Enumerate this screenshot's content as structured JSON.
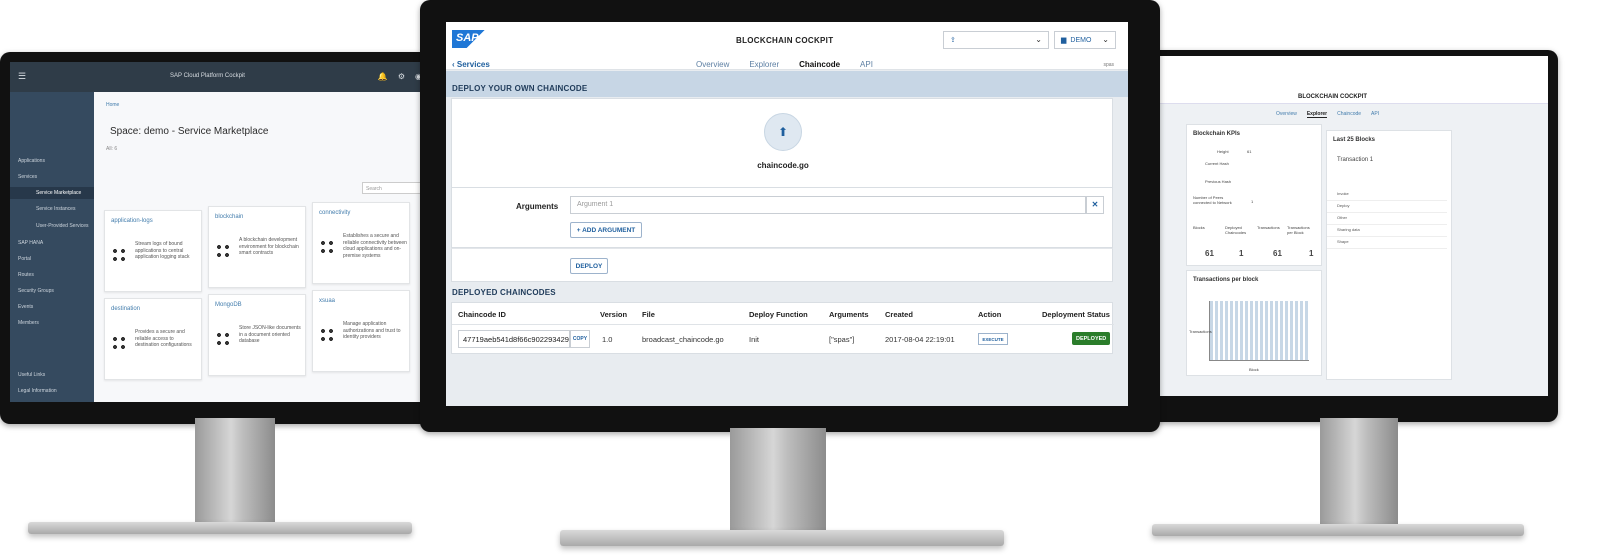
{
  "left_screen": {
    "title": "SAP Cloud Platform Cockpit",
    "sidebar": {
      "items": [
        "Applications",
        "Services",
        "SAP HANA",
        "Portal",
        "Routes",
        "Security Groups",
        "Events",
        "Members"
      ],
      "sub_items": [
        "Service Marketplace",
        "Service Instances",
        "User-Provided Services"
      ],
      "footer": [
        "Useful Links",
        "Legal Information"
      ]
    },
    "breadcrumb": "Home",
    "heading": "Space: demo - Service Marketplace",
    "count": "All: 6",
    "search_placeholder": "Search",
    "tiles": [
      {
        "title": "application-logs",
        "desc": "Stream logs of bound applications to central application logging stack"
      },
      {
        "title": "blockchain",
        "desc": "A blockchain development environment for blockchain smart contracts"
      },
      {
        "title": "connectivity",
        "desc": "Establishes a secure and reliable connectivity between cloud applications and on-premise systems"
      },
      {
        "title": "destination",
        "desc": "Provides a secure and reliable access to destination configurations"
      },
      {
        "title": "MongoDB",
        "desc": "Store JSON-like documents in a document oriented database"
      },
      {
        "title": "xsuaa",
        "desc": "Manage application authorizations and trust to identity providers"
      }
    ]
  },
  "right_screen": {
    "title": "BLOCKCHAIN COCKPIT",
    "tabs": [
      "Overview",
      "Explorer",
      "Chaincode",
      "API"
    ],
    "active_tab": "Explorer",
    "kpi_title": "Blockchain KPIs",
    "kpis": [
      {
        "label": "Height",
        "value": "61"
      },
      {
        "label": "Current Hash",
        "value": ""
      },
      {
        "label": "Previous Hash",
        "value": ""
      },
      {
        "label": "Number of Peers connected to Network",
        "value": "1"
      }
    ],
    "stats": [
      {
        "label": "Blocks",
        "value": "61"
      },
      {
        "label": "Deployed Chaincodes",
        "value": "1"
      },
      {
        "label": "Transactions",
        "value": "61"
      },
      {
        "label": "Transactions per Block",
        "value": "1"
      }
    ],
    "chart_title": "Transactions per block",
    "chart_xlabel": "Block",
    "chart_ylabel": "Transactions",
    "list_title": "Last 25 Blocks",
    "list_item": "Transaction 1",
    "list_rows": [
      "Invoke",
      "Deploy",
      "Other",
      "Sharing data",
      "Shape"
    ]
  },
  "center_screen": {
    "logo": "SAP",
    "app_title": "BLOCKCHAIN COCKPIT",
    "node_select": "",
    "space_select": "DEMO",
    "back_link": "Services",
    "tabs": [
      "Overview",
      "Explorer",
      "Chaincode",
      "API"
    ],
    "active_tab_index": 2,
    "user": "spas",
    "deploy_section": {
      "title": "DEPLOY YOUR OWN CHAINCODE",
      "file": "chaincode.go",
      "arguments_label": "Arguments",
      "argument_placeholder": "Argument 1",
      "add_argument": "+ ADD ARGUMENT",
      "deploy": "DEPLOY"
    },
    "deployed_section": {
      "title": "DEPLOYED CHAINCODES",
      "columns": [
        "Chaincode ID",
        "Version",
        "File",
        "Deploy Function",
        "Arguments",
        "Created",
        "Action",
        "Deployment Status"
      ],
      "rows": [
        {
          "id": "47719aeb541d8f66c902293429",
          "copy": "COPY",
          "version": "1.0",
          "file": "broadcast_chaincode.go",
          "function": "Init",
          "arguments": "[\"spas\"]",
          "created": "2017-08-04 22:19:01",
          "action": "EXECUTE",
          "status": "DEPLOYED"
        }
      ]
    }
  },
  "colors": {
    "accent": "#1f5f9e",
    "band": "#c7d6e5",
    "sidebar": "#354a5f",
    "deployed": "#2b7d2b"
  }
}
